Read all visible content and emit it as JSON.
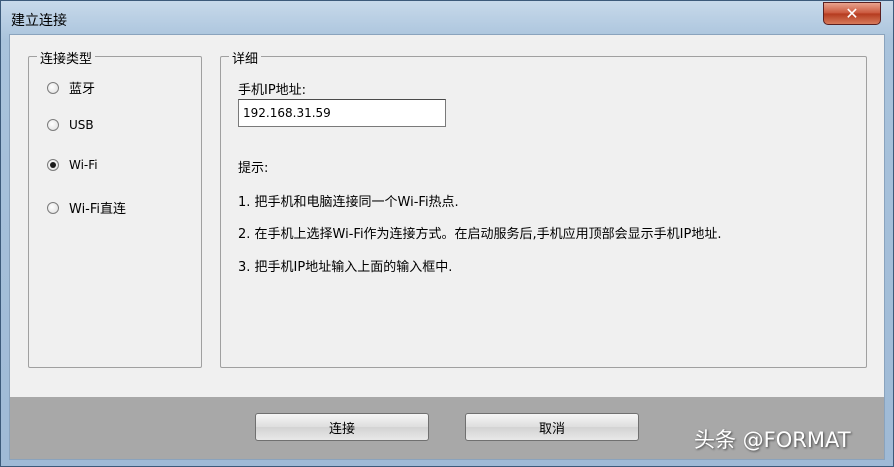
{
  "window": {
    "title": "建立连接",
    "close_glyph": "✕"
  },
  "connection_type": {
    "legend": "连接类型",
    "options": [
      {
        "label": "蓝牙",
        "checked": false
      },
      {
        "label": "USB",
        "checked": false
      },
      {
        "label": "Wi-Fi",
        "checked": true
      },
      {
        "label": "Wi-Fi直连",
        "checked": false
      }
    ]
  },
  "details": {
    "legend": "详细",
    "ip_label": "手机IP地址:",
    "ip_value": "192.168.31.59",
    "hint_title": "提示:",
    "hints": [
      "1. 把手机和电脑连接同一个Wi-Fi热点.",
      "2. 在手机上选择Wi-Fi作为连接方式。在启动服务后,手机应用顶部会显示手机IP地址.",
      "3. 把手机IP地址输入上面的输入框中."
    ]
  },
  "buttons": {
    "connect": "连接",
    "cancel": "取消"
  },
  "watermark": "头条 @FORMAT"
}
